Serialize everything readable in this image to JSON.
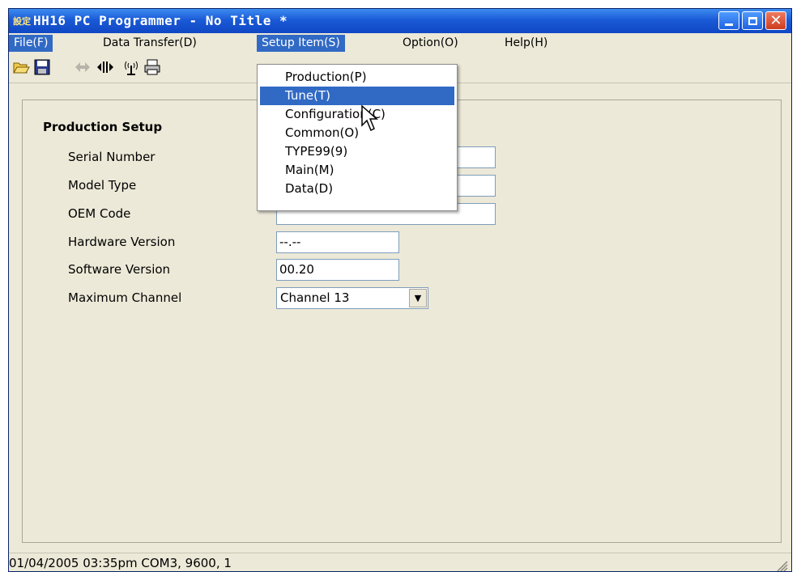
{
  "window": {
    "title": "HH16 PC Programmer - No Title *",
    "app_icon_glyph": "設定"
  },
  "menubar": {
    "items": [
      {
        "label": "File(F)"
      },
      {
        "label": "Data Transfer(D)"
      },
      {
        "label": "Setup Item(S)"
      },
      {
        "label": "Option(O)"
      },
      {
        "label": "Help(H)"
      }
    ]
  },
  "toolbar": {
    "icons": [
      "open-folder-icon",
      "save-icon",
      "arrow-icon",
      "transfer-icon",
      "radio-icon",
      "printer-icon"
    ]
  },
  "setup_menu": {
    "items": [
      {
        "label": "Production(P)"
      },
      {
        "label": "Tune(T)"
      },
      {
        "label": "Configuration(C)"
      },
      {
        "label": "Common(O)"
      },
      {
        "label": "TYPE99(9)"
      },
      {
        "label": "Main(M)"
      },
      {
        "label": "Data(D)"
      }
    ],
    "highlighted": "Tune(T)"
  },
  "form": {
    "title": "Production Setup",
    "serial_number_label": "Serial Number",
    "serial_number_value": "",
    "model_type_label": "Model Type",
    "model_type_value": "",
    "oem_code_label": "OEM Code",
    "oem_code_value": "",
    "hardware_version_label": "Hardware Version",
    "hardware_version_value": "--.--",
    "software_version_label": "Software Version",
    "software_version_value": "00.20",
    "max_channel_label": "Maximum Channel",
    "max_channel_value": "Channel 13"
  },
  "status": {
    "text": "01/04/2005 03:35pm COM3, 9600, 1"
  },
  "colors": {
    "title_bar": "#1a5ad6",
    "menu_highlight": "#316ac5",
    "window_bg": "#ece9d8",
    "close_button": "#cf3b1d"
  }
}
